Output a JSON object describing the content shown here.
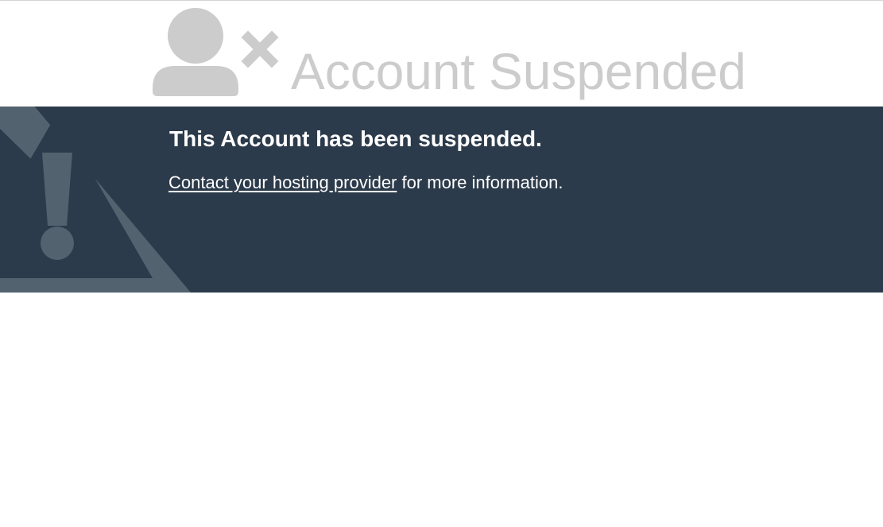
{
  "header": {
    "title": "Account Suspended",
    "icon": "user-remove-icon"
  },
  "banner": {
    "heading": "This Account has been suspended.",
    "link_text": "Contact your hosting provider",
    "trailing_text": " for more information.",
    "background_icon": "warning-triangle-icon"
  },
  "colors": {
    "banner_background": "#2c3b4b",
    "header_gray": "#cccccc",
    "banner_text": "#ffffff",
    "warning_icon": "#52626f"
  }
}
